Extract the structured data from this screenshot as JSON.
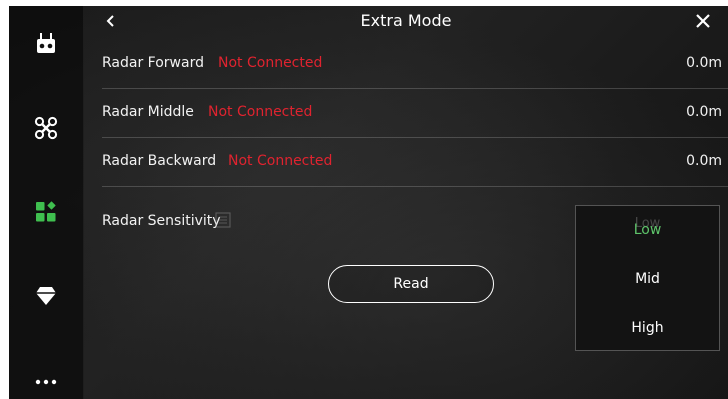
{
  "header": {
    "title": "Extra Mode"
  },
  "sidebar": {
    "items": [
      {
        "icon": "remote-controller-icon"
      },
      {
        "icon": "drone-icon"
      },
      {
        "icon": "modules-icon"
      },
      {
        "icon": "gem-icon"
      },
      {
        "icon": "more-icon"
      }
    ]
  },
  "radar_rows": [
    {
      "label": "Radar Forward",
      "status": "Not Connected",
      "value": "0.0m"
    },
    {
      "label": "Radar Middle",
      "status": "Not Connected",
      "value": "0.0m"
    },
    {
      "label": "Radar Backward",
      "status": "Not Connected",
      "value": "0.0m"
    }
  ],
  "sensitivity": {
    "label": "Radar Sensitivity",
    "current": "Low",
    "options": [
      "Low",
      "Mid",
      "High"
    ]
  },
  "read_button": {
    "label": "Read"
  },
  "colors": {
    "status_error": "#e0232f",
    "accent_green": "#5ec46a",
    "active_icon": "#3fbf4f"
  }
}
